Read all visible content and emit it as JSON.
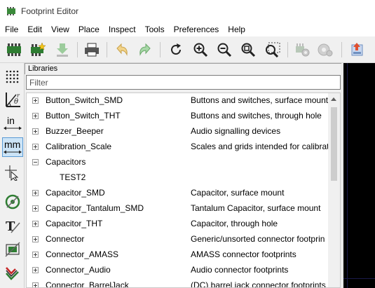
{
  "window": {
    "title": "Footprint Editor"
  },
  "menu": [
    "File",
    "Edit",
    "View",
    "Place",
    "Inspect",
    "Tools",
    "Preferences",
    "Help"
  ],
  "toolbar": {
    "icons": [
      "new-footprint-icon",
      "new-footprint-wizard-icon",
      "save-icon",
      "print-icon",
      "undo-icon",
      "redo-icon",
      "refresh-icon",
      "zoom-in-icon",
      "zoom-out-icon",
      "zoom-fit-icon",
      "zoom-selection-icon",
      "footprint-properties-icon",
      "pad-settings-icon",
      "load-from-board-icon"
    ]
  },
  "left_toolbar": {
    "units_inch": "in",
    "units_mm": "mm",
    "active": "mm"
  },
  "libraries": {
    "header": "Libraries",
    "filter_placeholder": "Filter",
    "rows": [
      {
        "name": "Button_Switch_SMD",
        "desc": "Buttons and switches, surface mount",
        "expanded": false
      },
      {
        "name": "Button_Switch_THT",
        "desc": "Buttons and switches, through hole",
        "expanded": false
      },
      {
        "name": "Buzzer_Beeper",
        "desc": "Audio signalling devices",
        "expanded": false
      },
      {
        "name": "Calibration_Scale",
        "desc": "Scales and grids intended for calibrat",
        "expanded": false
      },
      {
        "name": "Capacitors",
        "desc": "",
        "expanded": true
      },
      {
        "name": "TEST2",
        "desc": "",
        "child": true
      },
      {
        "name": "Capacitor_SMD",
        "desc": "Capacitor, surface mount",
        "expanded": false
      },
      {
        "name": "Capacitor_Tantalum_SMD",
        "desc": "Tantalum Capacitor, surface mount",
        "expanded": false
      },
      {
        "name": "Capacitor_THT",
        "desc": "Capacitor, through hole",
        "expanded": false
      },
      {
        "name": "Connector",
        "desc": "Generic/unsorted connector footprin",
        "expanded": false
      },
      {
        "name": "Connector_AMASS",
        "desc": "AMASS connector footprints",
        "expanded": false
      },
      {
        "name": "Connector_Audio",
        "desc": "Audio connector footprints",
        "expanded": false
      },
      {
        "name": "Connector_BarrelJack",
        "desc": "(DC) barrel jack connector footprints",
        "expanded": false
      }
    ]
  }
}
